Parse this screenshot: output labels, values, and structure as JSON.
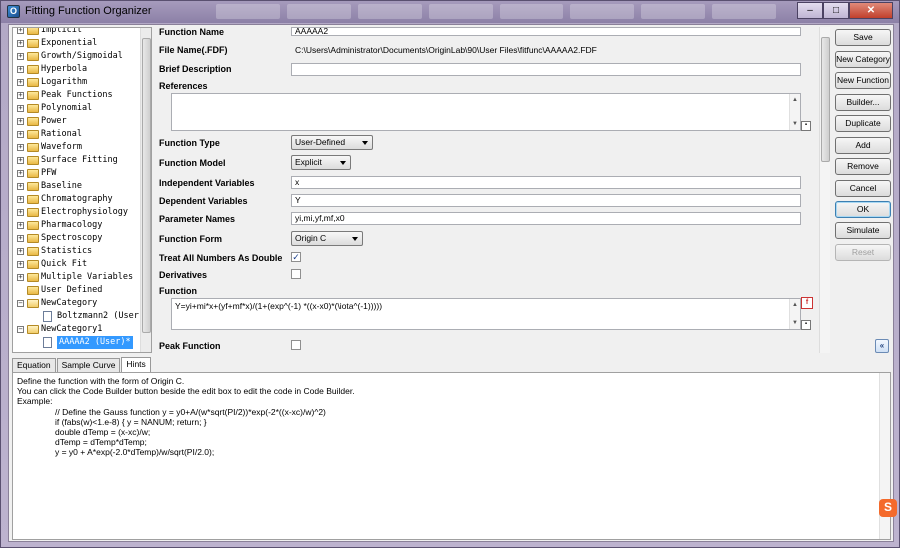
{
  "window": {
    "title": "Fitting Function Organizer",
    "app_icon": "origin-app-icon",
    "min": "–",
    "max": "□",
    "close": "✕"
  },
  "tree": {
    "items": [
      {
        "label": "Implicit",
        "type": "folder",
        "expander": "+"
      },
      {
        "label": "Exponential",
        "type": "folder",
        "expander": "+"
      },
      {
        "label": "Growth/Sigmoidal",
        "type": "folder",
        "expander": "+"
      },
      {
        "label": "Hyperbola",
        "type": "folder",
        "expander": "+"
      },
      {
        "label": "Logarithm",
        "type": "folder",
        "expander": "+"
      },
      {
        "label": "Peak Functions",
        "type": "folder",
        "expander": "+"
      },
      {
        "label": "Polynomial",
        "type": "folder",
        "expander": "+"
      },
      {
        "label": "Power",
        "type": "folder",
        "expander": "+"
      },
      {
        "label": "Rational",
        "type": "folder",
        "expander": "+"
      },
      {
        "label": "Waveform",
        "type": "folder",
        "expander": "+"
      },
      {
        "label": "Surface Fitting",
        "type": "folder",
        "expander": "+"
      },
      {
        "label": "PFW",
        "type": "folder",
        "expander": "+"
      },
      {
        "label": "Baseline",
        "type": "folder",
        "expander": "+"
      },
      {
        "label": "Chromatography",
        "type": "folder",
        "expander": "+"
      },
      {
        "label": "Electrophysiology",
        "type": "folder",
        "expander": "+"
      },
      {
        "label": "Pharmacology",
        "type": "folder",
        "expander": "+"
      },
      {
        "label": "Spectroscopy",
        "type": "folder",
        "expander": "+"
      },
      {
        "label": "Statistics",
        "type": "folder",
        "expander": "+"
      },
      {
        "label": "Quick Fit",
        "type": "folder",
        "expander": "+"
      },
      {
        "label": "Multiple Variables",
        "type": "folder",
        "expander": "+"
      },
      {
        "label": "User Defined",
        "type": "folder",
        "expander": ""
      },
      {
        "label": "NewCategory",
        "type": "open-folder",
        "expander": "−"
      },
      {
        "label": "Boltzmann2 (User)",
        "type": "file",
        "expander": ""
      },
      {
        "label": "NewCategory1",
        "type": "open-folder",
        "expander": "−"
      },
      {
        "label": "AAAAA2 (User)*",
        "type": "file",
        "expander": "",
        "selected": true
      }
    ]
  },
  "form": {
    "function_name": {
      "label": "Function Name",
      "value": "AAAAA2"
    },
    "file_name": {
      "label": "File Name(.FDF)",
      "value": "C:\\Users\\Administrator\\Documents\\OriginLab\\90\\User Files\\fitfunc\\AAAAA2.FDF"
    },
    "brief_description": {
      "label": "Brief Description",
      "value": ""
    },
    "references": {
      "label": "References",
      "value": ""
    },
    "function_type": {
      "label": "Function Type",
      "value": "User-Defined"
    },
    "function_model": {
      "label": "Function Model",
      "value": "Explicit"
    },
    "independent_variables": {
      "label": "Independent Variables",
      "value": "x"
    },
    "dependent_variables": {
      "label": "Dependent Variables",
      "value": "Y"
    },
    "parameter_names": {
      "label": "Parameter Names",
      "value": "yi,mi,yf,mf,x0"
    },
    "function_form": {
      "label": "Function Form",
      "value": "Origin C"
    },
    "treat_double": {
      "label": "Treat All Numbers As Double",
      "checked": "✓"
    },
    "derivatives": {
      "label": "Derivatives",
      "checked": ""
    },
    "function": {
      "label": "Function",
      "value": "Y=yi+mi*x+(yf+mf*x)/(1+(exp^(-1) *((x-x0)*(\\iota^(-1)))))"
    },
    "peak_function": {
      "label": "Peak Function",
      "checked": ""
    }
  },
  "buttons": {
    "save": "Save",
    "new_category": "New Category",
    "new_function": "New Function",
    "builder": "Builder...",
    "duplicate": "Duplicate",
    "add": "Add",
    "remove": "Remove",
    "cancel": "Cancel",
    "ok": "OK",
    "simulate": "Simulate",
    "reset": "Reset"
  },
  "collapse_glyph": "«",
  "tabs": [
    "Equation",
    "Sample Curve",
    "Hints"
  ],
  "active_tab": "Hints",
  "hints": {
    "lines": [
      "Define the function with the form of Origin C.",
      "You can click the Code Builder button beside the edit box to edit the code in Code Builder.",
      "Example:"
    ],
    "code": [
      "// Define the Gauss function y = y0+A/(w*sqrt(PI/2))*exp(-2*((x-xc)/w)^2)",
      "if (fabs(w)<1.e-8) { y = NANUM; return; }",
      "double dTemp = (x-xc)/w;",
      "dTemp = dTemp*dTemp;",
      "y = y0 + A*exp(-2.0*dTemp)/w/sqrt(PI/2.0);"
    ]
  },
  "colors": {
    "selection": "#3399ff",
    "title_bar": "#8c80a7",
    "close_button": "#c1402c"
  }
}
